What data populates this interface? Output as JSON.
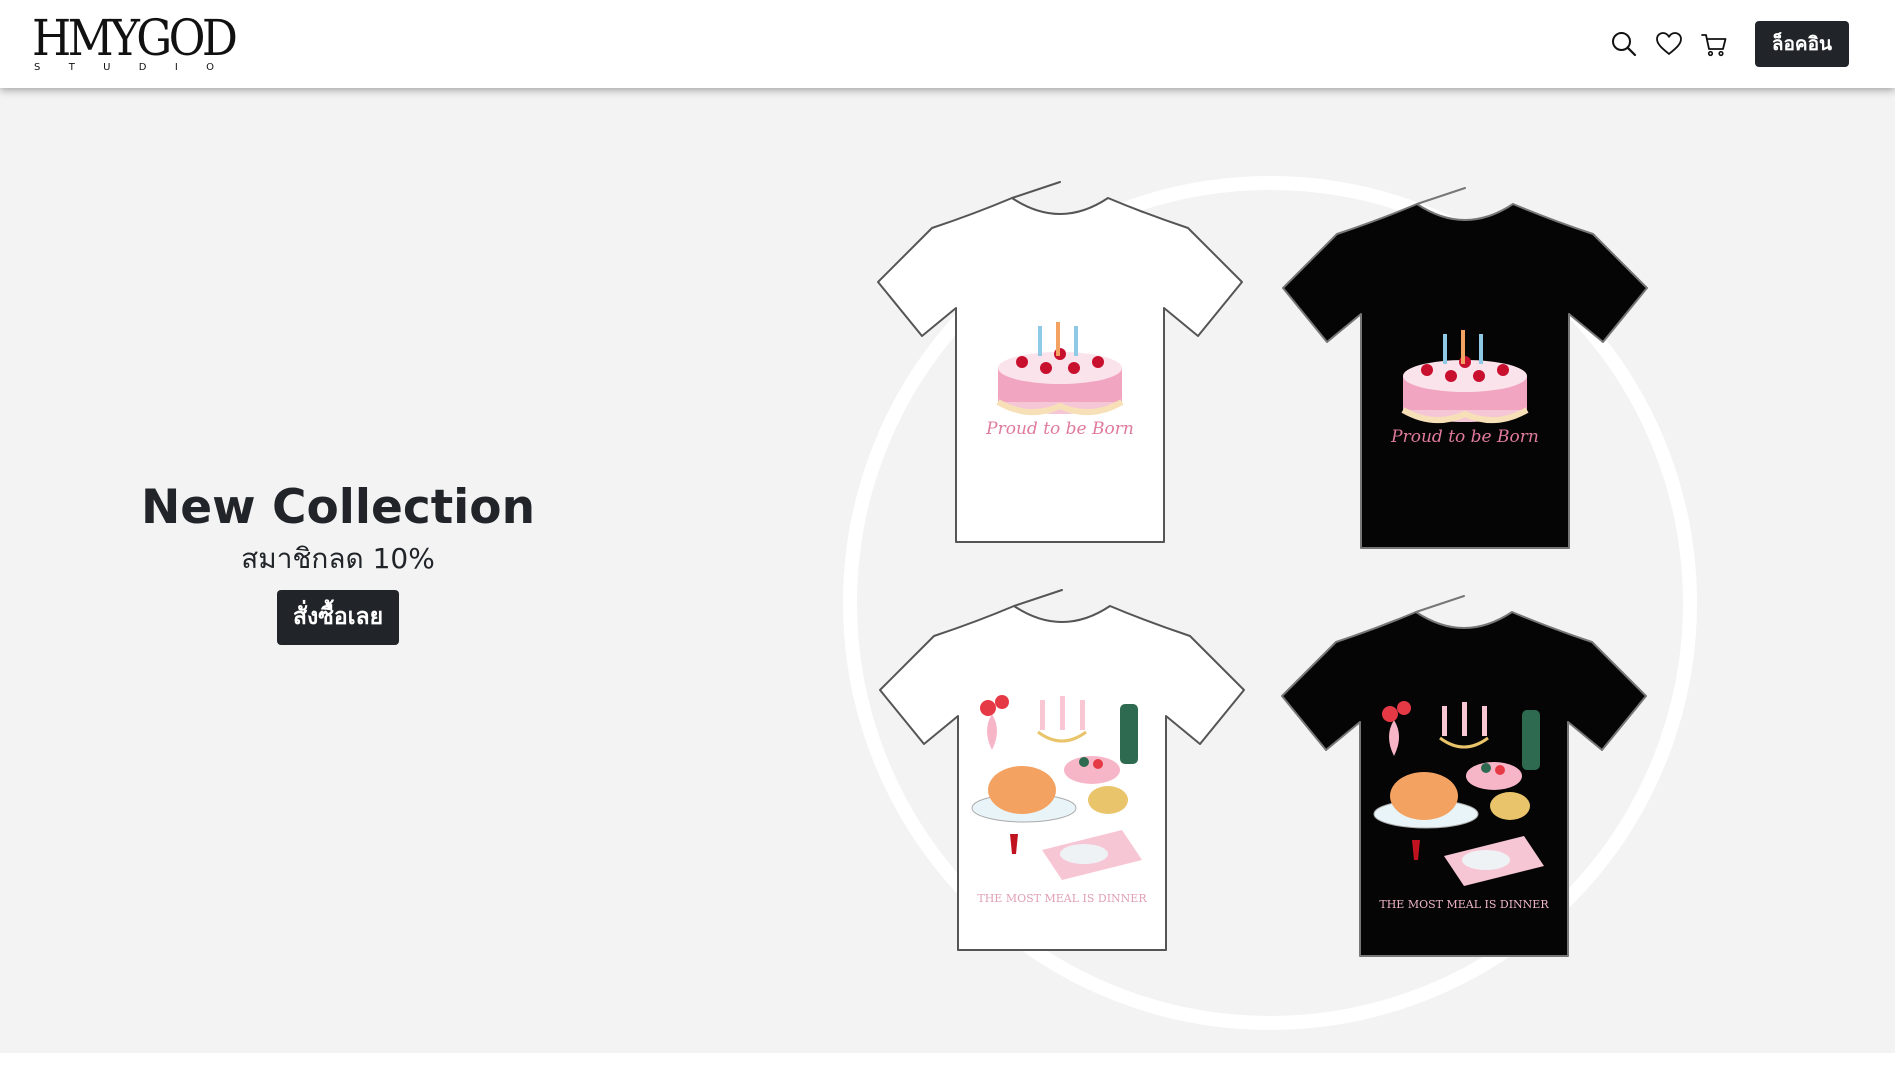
{
  "brand": {
    "logo_text": "HMYGOD",
    "logo_sub_letters": [
      "S",
      "T",
      "U",
      "D",
      "I",
      "O"
    ]
  },
  "nav": {
    "icons": [
      "search-icon",
      "heart-icon",
      "cart-icon"
    ],
    "login_label": "ล็อคอิน"
  },
  "hero": {
    "title": "New Collection",
    "subtitle": "สมาชิกลด 10%",
    "cta_label": "สั่งซื้อเลย",
    "products": [
      {
        "shirt_color": "white",
        "print_text": "Proud to be Born"
      },
      {
        "shirt_color": "black",
        "print_text": "Proud to be Born"
      },
      {
        "shirt_color": "white",
        "print_text": "THE MOST MEAL IS DINNER"
      },
      {
        "shirt_color": "black",
        "print_text": "THE MOST MEAL IS DINNER"
      }
    ]
  },
  "colors": {
    "nav_bg": "#ffffff",
    "hero_bg": "#f3f3f3",
    "button_bg": "#212529",
    "button_text": "#ffffff",
    "text_dark": "#212529"
  }
}
